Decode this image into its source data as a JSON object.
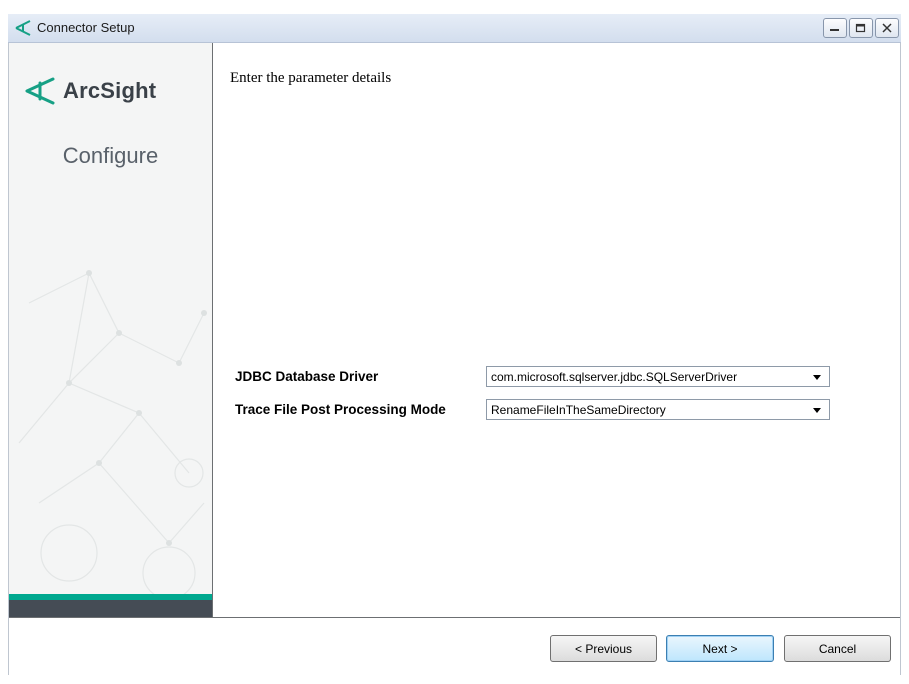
{
  "window": {
    "title": "Connector Setup",
    "icon": "arcsight-icon"
  },
  "sidebar": {
    "brand": "ArcSight",
    "step": "Configure"
  },
  "main": {
    "heading": "Enter the parameter details",
    "params": [
      {
        "label": "JDBC Database Driver",
        "value": "com.microsoft.sqlserver.jdbc.SQLServerDriver"
      },
      {
        "label": "Trace File Post Processing Mode",
        "value": "RenameFileInTheSameDirectory"
      }
    ]
  },
  "footer": {
    "previous_label": "< Previous",
    "next_label": "Next >",
    "cancel_label": "Cancel"
  },
  "colors": {
    "accent_teal": "#00a88f",
    "sidebar_dark": "#454c55"
  }
}
